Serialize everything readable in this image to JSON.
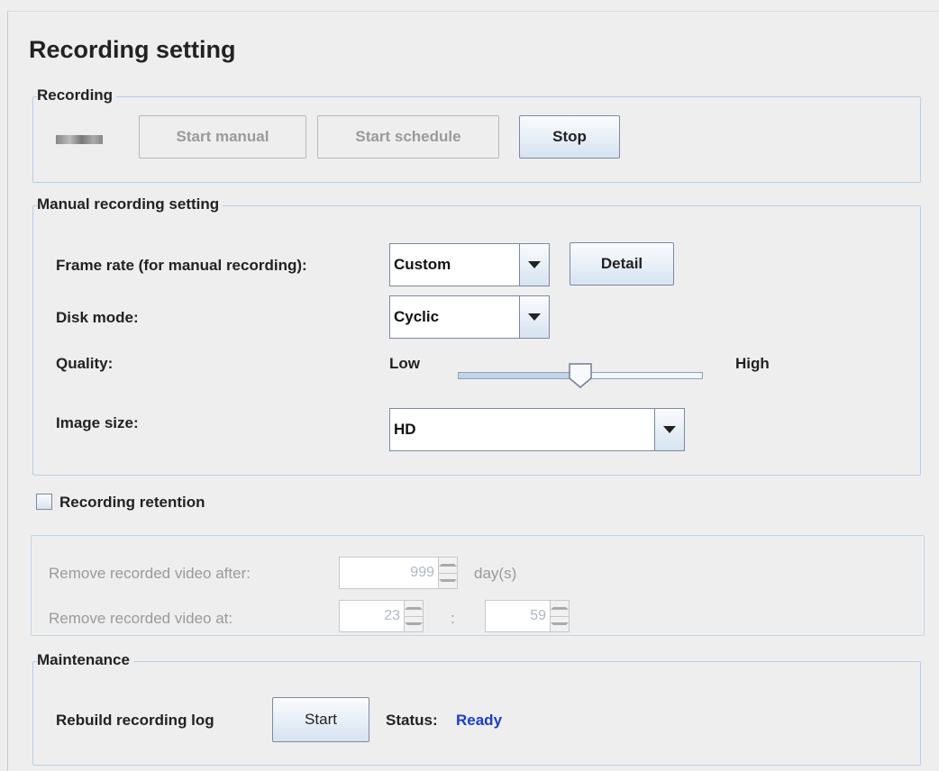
{
  "title": "Recording setting",
  "recording": {
    "legend": "Recording",
    "start_manual": "Start manual",
    "start_schedule": "Start schedule",
    "stop": "Stop"
  },
  "manual": {
    "legend": "Manual recording setting",
    "frame_rate_label": "Frame rate (for manual recording):",
    "frame_rate_value": "Custom",
    "detail": "Detail",
    "disk_mode_label": "Disk mode:",
    "disk_mode_value": "Cyclic",
    "quality_label": "Quality:",
    "quality_low": "Low",
    "quality_high": "High",
    "quality_level": 0.5,
    "image_size_label": "Image size:",
    "image_size_value": "HD"
  },
  "retention": {
    "checkbox_label": "Recording retention",
    "checked": false,
    "remove_after_label": "Remove recorded video after:",
    "remove_after_value": "999",
    "days_unit": "day(s)",
    "remove_at_label": "Remove recorded video at:",
    "hour_value": "23",
    "separator": ":",
    "minute_value": "59"
  },
  "maintenance": {
    "legend": "Maintenance",
    "rebuild_label": "Rebuild recording log",
    "start": "Start",
    "status_label": "Status:",
    "status_value": "Ready",
    "status_color": "#1a3cd8"
  },
  "colors": {
    "background": "#eeeeee",
    "group_border": "#b8cfe5",
    "button_gradient_top": "#fbfcfe",
    "button_gradient_bottom": "#d6e3f1"
  }
}
